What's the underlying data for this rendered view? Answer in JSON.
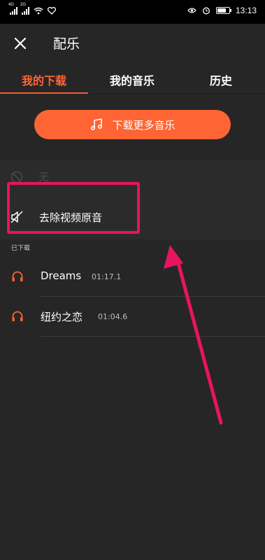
{
  "status_bar": {
    "signal1_tag": "4G",
    "signal2_tag": "2G",
    "time": "13:13",
    "battery_level": 0.75
  },
  "header": {
    "close_icon": "close-icon",
    "title": "配乐"
  },
  "tabs": [
    {
      "label": "我的下载",
      "active": true
    },
    {
      "label": "我的音乐",
      "active": false
    },
    {
      "label": "历史",
      "active": false
    }
  ],
  "download_more_button": {
    "label": "下载更多音乐",
    "icon": "music-note-icon"
  },
  "options": [
    {
      "label": "无",
      "icon": "no-entry-icon",
      "disabled": true
    },
    {
      "label": "去除视频原音",
      "icon": "mute-icon",
      "disabled": false
    }
  ],
  "downloaded_section_label": "已下载",
  "tracks": [
    {
      "name": "Dreams",
      "duration": "01:17.1",
      "icon": "headphones-icon"
    },
    {
      "name": "纽约之恋",
      "duration": "01:04.6",
      "icon": "headphones-icon"
    }
  ],
  "colors": {
    "accent": "#ff6434",
    "annotation": "#e8145f",
    "background": "#262626"
  }
}
